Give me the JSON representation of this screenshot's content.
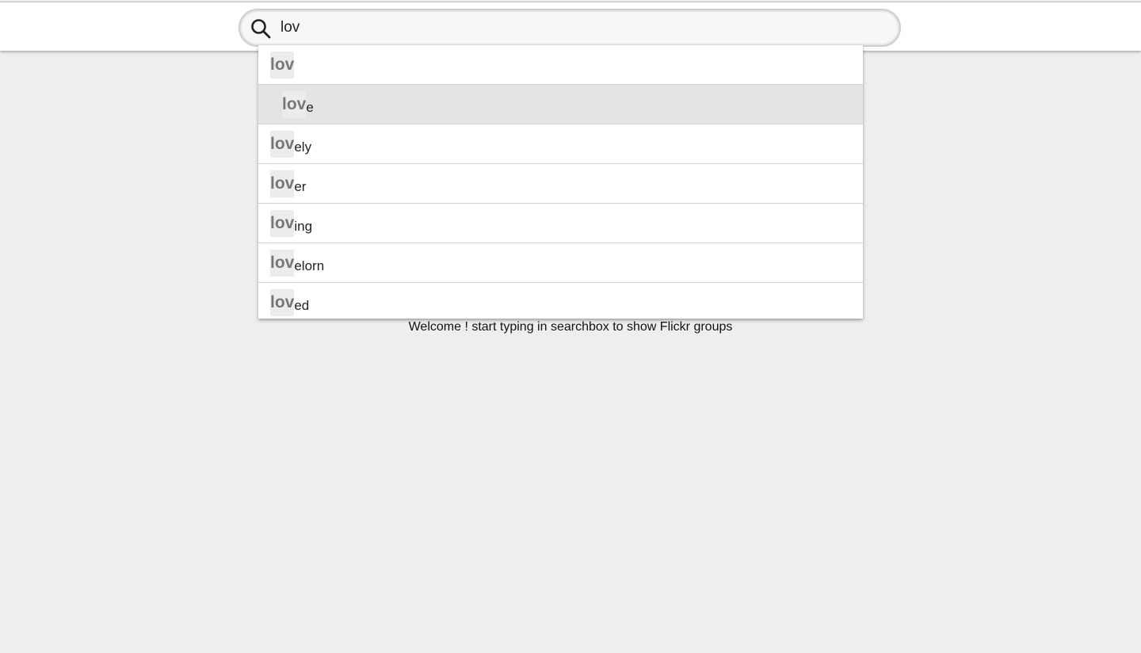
{
  "search": {
    "value": "lov",
    "icon": "search-icon"
  },
  "suggestions": [
    {
      "match": "lov",
      "rest": ""
    },
    {
      "match": "lov",
      "rest": "e",
      "selected": true
    },
    {
      "match": "lov",
      "rest": "ely"
    },
    {
      "match": "lov",
      "rest": "er"
    },
    {
      "match": "lov",
      "rest": "ing"
    },
    {
      "match": "lov",
      "rest": "elorn"
    },
    {
      "match": "lov",
      "rest": "ed"
    }
  ],
  "welcome_text": "Welcome ! start typing in searchbox to show Flickr groups"
}
